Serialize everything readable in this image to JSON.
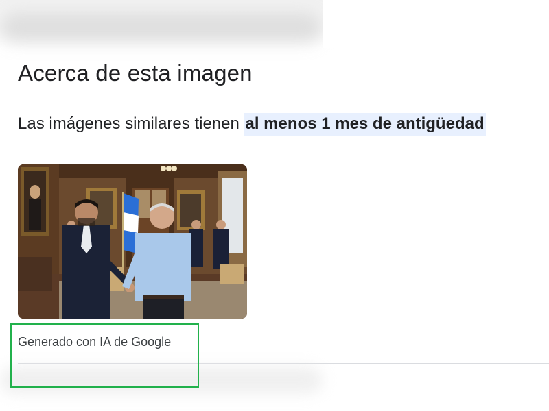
{
  "page": {
    "title": "Acerca de esta imagen",
    "subtitle_prefix": "Las imágenes similares tienen ",
    "subtitle_highlight": "al menos 1 mes de antigüedad",
    "caption": "Generado con IA de Google"
  },
  "colors": {
    "highlight_bg": "#e8f0fe",
    "annotation_box": "#22b14c",
    "flag_blue": "#2b6fd6"
  },
  "image": {
    "icon": "photo-two-men-handshake"
  }
}
